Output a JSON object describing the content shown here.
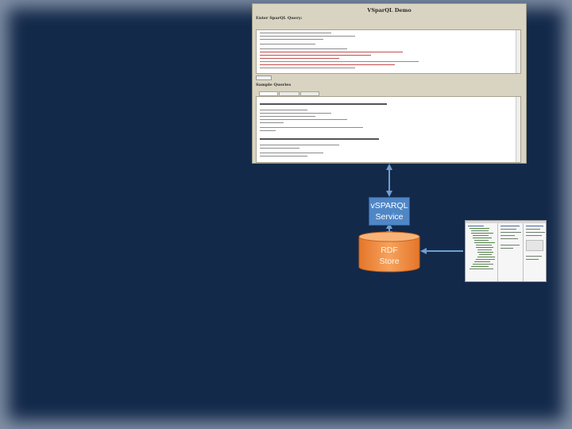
{
  "web_screenshot": {
    "page_title": "VSparQL Demo",
    "query_heading": "Enter SparQL Query:",
    "samples_heading": "Sample Queries"
  },
  "service": {
    "line1": "vSPARQL",
    "line2": "Service"
  },
  "rdf_store": {
    "line1": "RDF",
    "line2": "Store"
  },
  "colors": {
    "background": "#13294a",
    "service_fill": "#4f86c6",
    "store_fill": "#f08a3a",
    "arrow": "#6f9fd0"
  }
}
